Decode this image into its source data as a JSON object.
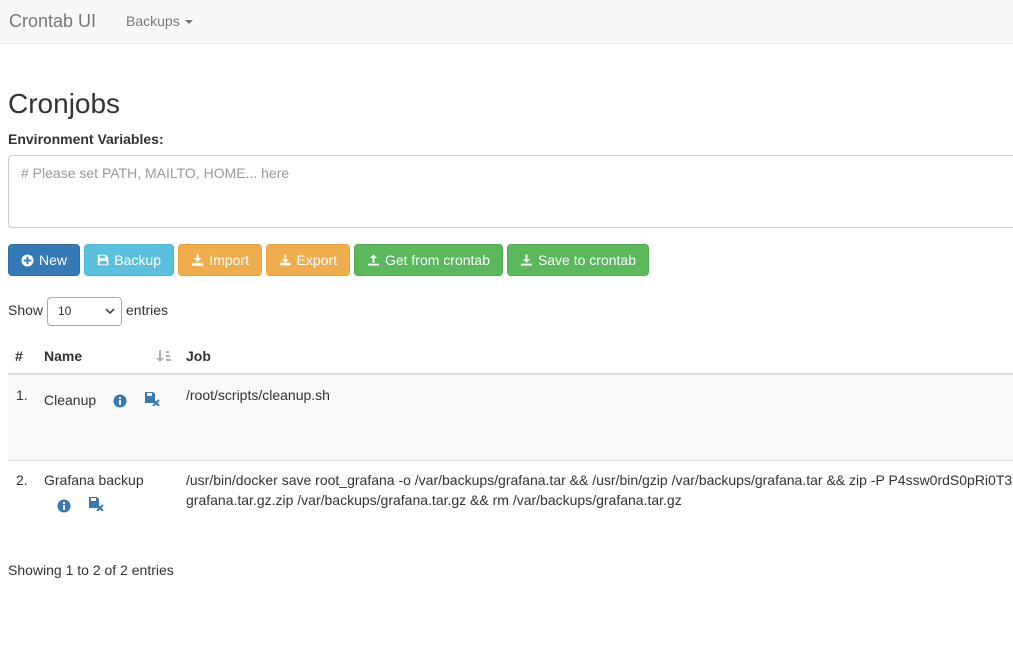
{
  "navbar": {
    "brand": "Crontab UI",
    "backups_menu": "Backups"
  },
  "page": {
    "title": "Cronjobs"
  },
  "env": {
    "label": "Environment Variables:",
    "placeholder": "# Please set PATH, MAILTO, HOME... here",
    "value": ""
  },
  "toolbar": {
    "new_label": "New",
    "backup_label": "Backup",
    "import_label": "Import",
    "export_label": "Export",
    "get_label": "Get from crontab",
    "save_label": "Save to crontab"
  },
  "length_menu": {
    "show": "Show",
    "selected": "10",
    "entries": "entries"
  },
  "table": {
    "headers": {
      "index": "#",
      "name": "Name",
      "job": "Job"
    },
    "rows": [
      {
        "index": "1.",
        "name": "Cleanup",
        "job": "/root/scripts/cleanup.sh"
      },
      {
        "index": "2.",
        "name": "Grafana backup",
        "job": "/usr/bin/docker save root_grafana -o /var/backups/grafana.tar && /usr/bin/gzip /var/backups/grafana.tar && zip -P P4ssw0rdS0pRi0T3 grafana.tar.gz.zip /var/backups/grafana.tar.gz && rm /var/backups/grafana.tar.gz"
      }
    ]
  },
  "info": "Showing 1 to 2 of 2 entries",
  "colors": {
    "primary": "#337ab7",
    "info": "#5bc0de",
    "warning": "#f0ad4e",
    "success": "#5cb85c"
  },
  "icons": [
    "plus-circle-icon",
    "floppy-icon",
    "import-icon",
    "download-icon",
    "upload-icon",
    "info-circle-icon",
    "floppy-remove-icon",
    "sort-icon",
    "caret-down-icon"
  ]
}
